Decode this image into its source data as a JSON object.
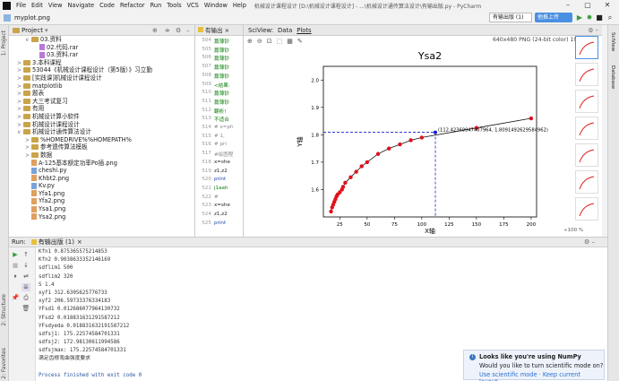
{
  "menu": [
    "File",
    "Edit",
    "View",
    "Navigate",
    "Code",
    "Refactor",
    "Run",
    "Tools",
    "VCS",
    "Window",
    "Help"
  ],
  "window_title": "机械设计课程设计 [D:\\机械设计课程设计] - ...\\机械设计通传算法设计\\有输出版.py - PyCharm",
  "breadcrumb": "myplot.png",
  "run_config": "有输出版 (1)",
  "upload_label": "他推上传",
  "project": {
    "title": "Project",
    "items": [
      {
        "indent": 2,
        "arrow": "∨",
        "kind": "folder",
        "label": "03.资料"
      },
      {
        "indent": 3,
        "arrow": "",
        "kind": "rar",
        "label": "02.代码.rar"
      },
      {
        "indent": 3,
        "arrow": "",
        "kind": "rar",
        "label": "03.资料.rar"
      },
      {
        "indent": 1,
        "arrow": ">",
        "kind": "folder",
        "label": "3.本科课程"
      },
      {
        "indent": 1,
        "arrow": ">",
        "kind": "folder",
        "label": "53044《机械设计课程设计（第5版）》习立勤"
      },
      {
        "indent": 1,
        "arrow": ">",
        "kind": "folder",
        "label": "[实践课]机械设计课程设计"
      },
      {
        "indent": 1,
        "arrow": ">",
        "kind": "folder",
        "label": "matplotlib"
      },
      {
        "indent": 1,
        "arrow": ">",
        "kind": "folder",
        "label": "题表"
      },
      {
        "indent": 1,
        "arrow": ">",
        "kind": "folder",
        "label": "大三考试复习"
      },
      {
        "indent": 1,
        "arrow": ">",
        "kind": "folder",
        "label": "有用"
      },
      {
        "indent": 1,
        "arrow": ">",
        "kind": "folder",
        "label": "机械设计算小软件"
      },
      {
        "indent": 1,
        "arrow": ">",
        "kind": "folder",
        "label": "机械设计课程设计"
      },
      {
        "indent": 1,
        "arrow": "∨",
        "kind": "folder",
        "label": "机械设计通传算法设计"
      },
      {
        "indent": 2,
        "arrow": ">",
        "kind": "folder",
        "label": "%HOMEDRIVE%%HOMEPATH%"
      },
      {
        "indent": 2,
        "arrow": ">",
        "kind": "folder",
        "label": "参考遗传算法模板"
      },
      {
        "indent": 2,
        "arrow": ">",
        "kind": "folder",
        "label": "数据"
      },
      {
        "indent": 2,
        "arrow": "",
        "kind": "png",
        "label": "A-125基本额定功率Po插.png"
      },
      {
        "indent": 2,
        "arrow": "",
        "kind": "py",
        "label": "cheshi.py"
      },
      {
        "indent": 2,
        "arrow": "",
        "kind": "png",
        "label": "Khbt2.png"
      },
      {
        "indent": 2,
        "arrow": "",
        "kind": "py",
        "label": "Kv.py"
      },
      {
        "indent": 2,
        "arrow": "",
        "kind": "png",
        "label": "Yfa1.png"
      },
      {
        "indent": 2,
        "arrow": "",
        "kind": "png",
        "label": "Yfa2.png"
      },
      {
        "indent": 2,
        "arrow": "",
        "kind": "png",
        "label": "Ysa1.png"
      },
      {
        "indent": 2,
        "arrow": "",
        "kind": "png",
        "label": "Ysa2.png"
      }
    ]
  },
  "editor": {
    "tab": "有输出",
    "lines": [
      "504",
      "505",
      "506",
      "507",
      "508",
      "509",
      "510",
      "511",
      "512",
      "513",
      "514",
      "515",
      "516",
      "517",
      "518",
      "519",
      "520",
      "521",
      "522",
      "523",
      "524",
      "525"
    ],
    "code": [
      "篇薄钞",
      "篇薄钞",
      "篇薄钞",
      "篇薄钞",
      "篇薄钞",
      "<结果:",
      "篇薄钞",
      "篇薄钞",
      "翻析!",
      "不适合",
      "# x=ph",
      "# 1,",
      "# pri",
      "#绘图程",
      "x=she",
      "z1,z2",
      "print",
      "j1aah",
      "#",
      "x=she",
      "z1,z2",
      "print"
    ]
  },
  "sciview": {
    "tab_label": "SciView:",
    "tabs": [
      "Data",
      "Plots"
    ],
    "info": "640x480 PNG (24-bit color) 19.92 kB",
    "zoom": "÷100 %"
  },
  "chart_data": {
    "type": "scatter",
    "title": "Ysa2",
    "xlabel": "X轴",
    "ylabel": "Y轴",
    "xlim": [
      10,
      205
    ],
    "ylim": [
      1.5,
      2.05
    ],
    "xticks": [
      25,
      50,
      75,
      100,
      125,
      150,
      175,
      200
    ],
    "yticks": [
      1.6,
      1.7,
      1.8,
      1.9,
      2.0
    ],
    "points": [
      [
        17,
        1.52
      ],
      [
        18,
        1.535
      ],
      [
        19,
        1.545
      ],
      [
        20,
        1.555
      ],
      [
        21,
        1.565
      ],
      [
        22,
        1.575
      ],
      [
        23,
        1.582
      ],
      [
        25,
        1.59
      ],
      [
        27,
        1.6
      ],
      [
        28,
        1.61
      ],
      [
        30,
        1.625
      ],
      [
        35,
        1.645
      ],
      [
        40,
        1.665
      ],
      [
        45,
        1.685
      ],
      [
        50,
        1.7
      ],
      [
        60,
        1.73
      ],
      [
        70,
        1.75
      ],
      [
        80,
        1.765
      ],
      [
        90,
        1.78
      ],
      [
        100,
        1.79
      ],
      [
        150,
        1.825
      ],
      [
        200,
        1.86
      ]
    ],
    "highlight": {
      "x": 112.42369947407964,
      "y": 1.8091492629584962,
      "label": "(112.42369947407964, 1.8091492629584962)"
    },
    "point_color": "#e0101a",
    "line_color": "#111111",
    "guide_color": "#1020c8"
  },
  "run": {
    "label": "Run:",
    "config": "有输出版 (1)",
    "console": [
      "Kfn1 0.875365575214853",
      "Kfn2 0.9038633352146169",
      "sdflim1 500",
      "sdflim2 320",
      "S 1.4",
      "xyf1 312.6305625776733",
      "xyf2 206.59733376334183",
      "YFsd1 0.012686077964130732",
      "YFsd2 0.018831631291587212",
      "YFsdyeda 0.018831632191587212",
      "sdfsj1: 175.22574584701331",
      "sdfsj2: 172.98130611994586",
      "sdfsjmax: 175.22574584701331",
      "满足齿根弯曲强度要求",
      "",
      "Process finished with exit code 0"
    ]
  },
  "notification": {
    "title": "Looks like you're using NumPy",
    "question": "Would you like to turn scientific mode on?",
    "links": "Use scientific mode · Keep current layout..."
  },
  "side_tabs_left": [
    "1: Project",
    "2: Structure",
    "2: Favorites"
  ],
  "side_tabs_right": [
    "SciView",
    "Database"
  ]
}
